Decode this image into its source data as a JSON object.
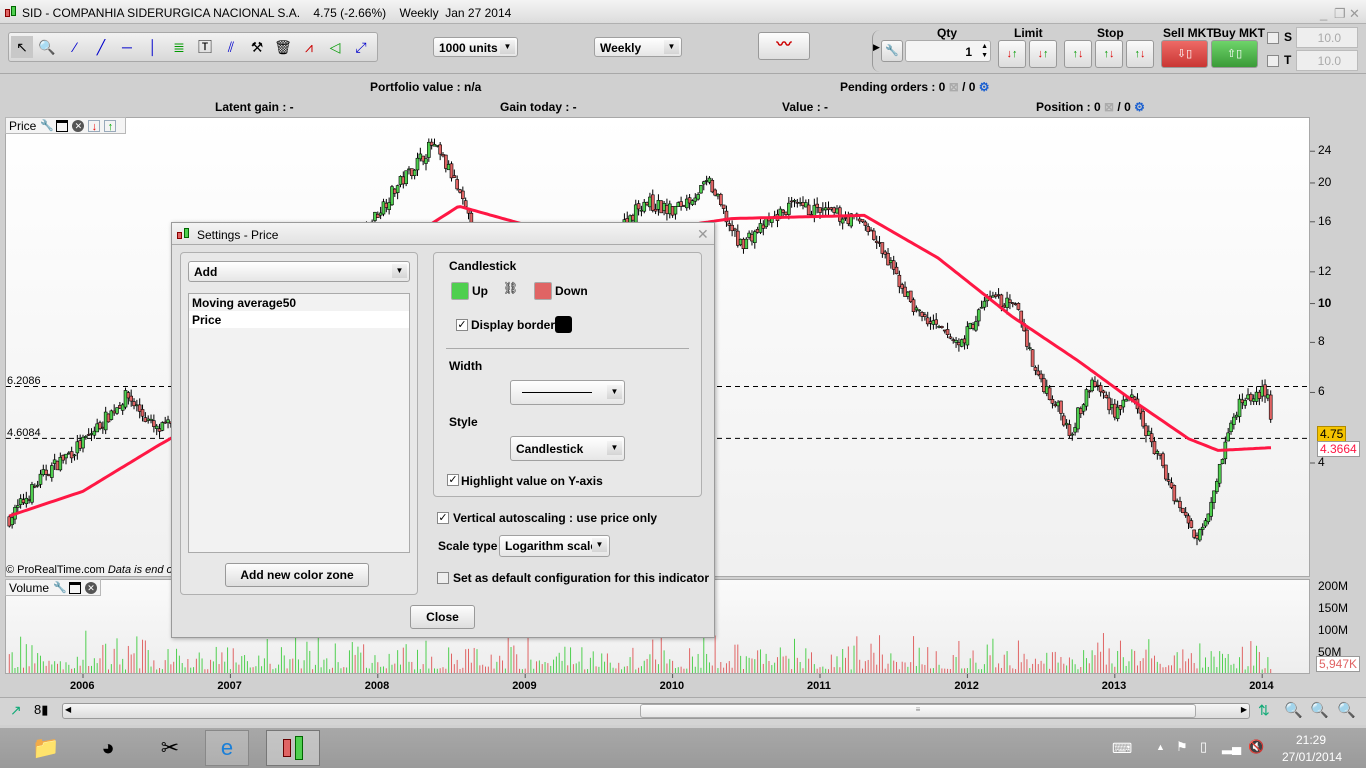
{
  "window": {
    "title": "SID - COMPANHIA SIDERURGICA NACIONAL S.A.",
    "last": "4.75 (-2.66%)",
    "period": "Weekly",
    "date": "Jan 27 2014"
  },
  "toolbar": {
    "units": "1000 units",
    "timeframe": "Weekly",
    "qty_label": "Qty",
    "qty_value": "1",
    "limit_label": "Limit",
    "stop_label": "Stop",
    "sell_label": "Sell MKT",
    "buy_label": "Buy MKT",
    "s_label": "S",
    "t_label": "T",
    "s_value": "10.0",
    "t_value": "10.0"
  },
  "info": {
    "portfolio": "Portfolio value : n/a",
    "pending": "Pending orders : 0",
    "pending2": "/ 0",
    "latent": "Latent gain : -",
    "gain_today": "Gain today : -",
    "value": "Value : -",
    "position": "Position : 0",
    "position2": "/ 0"
  },
  "panes": {
    "price": "Price",
    "volume": "Volume",
    "copyright": "© ProRealTime.com",
    "disclaimer": "Data is end o"
  },
  "dialog": {
    "title": "Settings - Price",
    "add": "Add",
    "list": [
      "Moving average50",
      "Price"
    ],
    "add_zone": "Add new color zone",
    "candlestick": "Candlestick",
    "up": "Up",
    "down": "Down",
    "display_border": "Display border",
    "width": "Width",
    "style": "Style",
    "style_value": "Candlestick",
    "highlight": "Highlight value on Y-axis",
    "autoscale": "Vertical autoscaling : use price only",
    "scale_type": "Scale type",
    "scale_value": "Logarithm scale",
    "default": "Set as default configuration for this indicator",
    "close": "Close"
  },
  "colors": {
    "up": "#4fcf4f",
    "down": "#e06464",
    "ma": "#ff1744",
    "sell": "#d9413f",
    "buy": "#3fa33f"
  },
  "taskbar": {
    "time": "21:29",
    "date": "27/01/2014"
  },
  "chart_data": {
    "type": "candlestick",
    "title": "SID weekly",
    "scale": "log",
    "y_ticks": [
      24,
      20,
      16,
      12,
      10,
      8,
      6,
      4
    ],
    "x_ticks": [
      "2006",
      "2007",
      "2008",
      "2009",
      "2010",
      "2011",
      "2012",
      "2013",
      "2014"
    ],
    "hlines": [
      {
        "label": "6.2086",
        "value": 6.2086
      },
      {
        "label": "4.6084",
        "value": 4.6084
      }
    ],
    "last_price": "4.75",
    "ma_value": "4.3664",
    "price_anchors": [
      [
        2005.5,
        2.9
      ],
      [
        2005.75,
        3.8
      ],
      [
        2006.0,
        4.5
      ],
      [
        2006.3,
        5.9
      ],
      [
        2006.5,
        4.8
      ],
      [
        2006.8,
        5.4
      ],
      [
        2007.0,
        6
      ],
      [
        2007.5,
        10
      ],
      [
        2007.9,
        15
      ],
      [
        2008.1,
        19
      ],
      [
        2008.37,
        25
      ],
      [
        2008.5,
        21
      ],
      [
        2008.75,
        12
      ],
      [
        2009.0,
        8
      ],
      [
        2009.4,
        12
      ],
      [
        2009.8,
        18
      ],
      [
        2010.0,
        17
      ],
      [
        2010.25,
        20
      ],
      [
        2010.45,
        14
      ],
      [
        2010.8,
        17.5
      ],
      [
        2011.0,
        17
      ],
      [
        2011.3,
        16
      ],
      [
        2011.5,
        12
      ],
      [
        2011.65,
        9.6
      ],
      [
        2011.8,
        8.6
      ],
      [
        2011.95,
        7.9
      ],
      [
        2012.05,
        9.1
      ],
      [
        2012.15,
        10.5
      ],
      [
        2012.35,
        9.6
      ],
      [
        2012.45,
        6.9
      ],
      [
        2012.6,
        5.6
      ],
      [
        2012.7,
        4.8
      ],
      [
        2012.85,
        6.4
      ],
      [
        2013.0,
        5.4
      ],
      [
        2013.1,
        5.9
      ],
      [
        2013.3,
        4.1
      ],
      [
        2013.45,
        3.05
      ],
      [
        2013.55,
        2.6
      ],
      [
        2013.65,
        3.2
      ],
      [
        2013.75,
        4.5
      ],
      [
        2013.85,
        5.7
      ],
      [
        2014.0,
        6.0
      ],
      [
        2014.05,
        5.7
      ],
      [
        2014.07,
        4.75
      ]
    ],
    "ma50_anchors": [
      [
        2005.5,
        2.95
      ],
      [
        2006.0,
        3.4
      ],
      [
        2006.5,
        4.4
      ],
      [
        2007.0,
        5.6
      ],
      [
        2007.5,
        8
      ],
      [
        2008.0,
        13
      ],
      [
        2008.55,
        17.5
      ],
      [
        2009.2,
        15
      ],
      [
        2010.0,
        15.5
      ],
      [
        2010.4,
        16.3
      ],
      [
        2011.3,
        16.6
      ],
      [
        2011.8,
        13
      ],
      [
        2012.3,
        9.3
      ],
      [
        2012.75,
        7.2
      ],
      [
        2013.1,
        5.8
      ],
      [
        2013.5,
        4.6
      ],
      [
        2013.7,
        4.3
      ],
      [
        2014.07,
        4.37
      ]
    ],
    "volume_ticks": [
      "200M",
      "150M",
      "100M",
      "50M"
    ],
    "last_volume": "5,947K"
  }
}
